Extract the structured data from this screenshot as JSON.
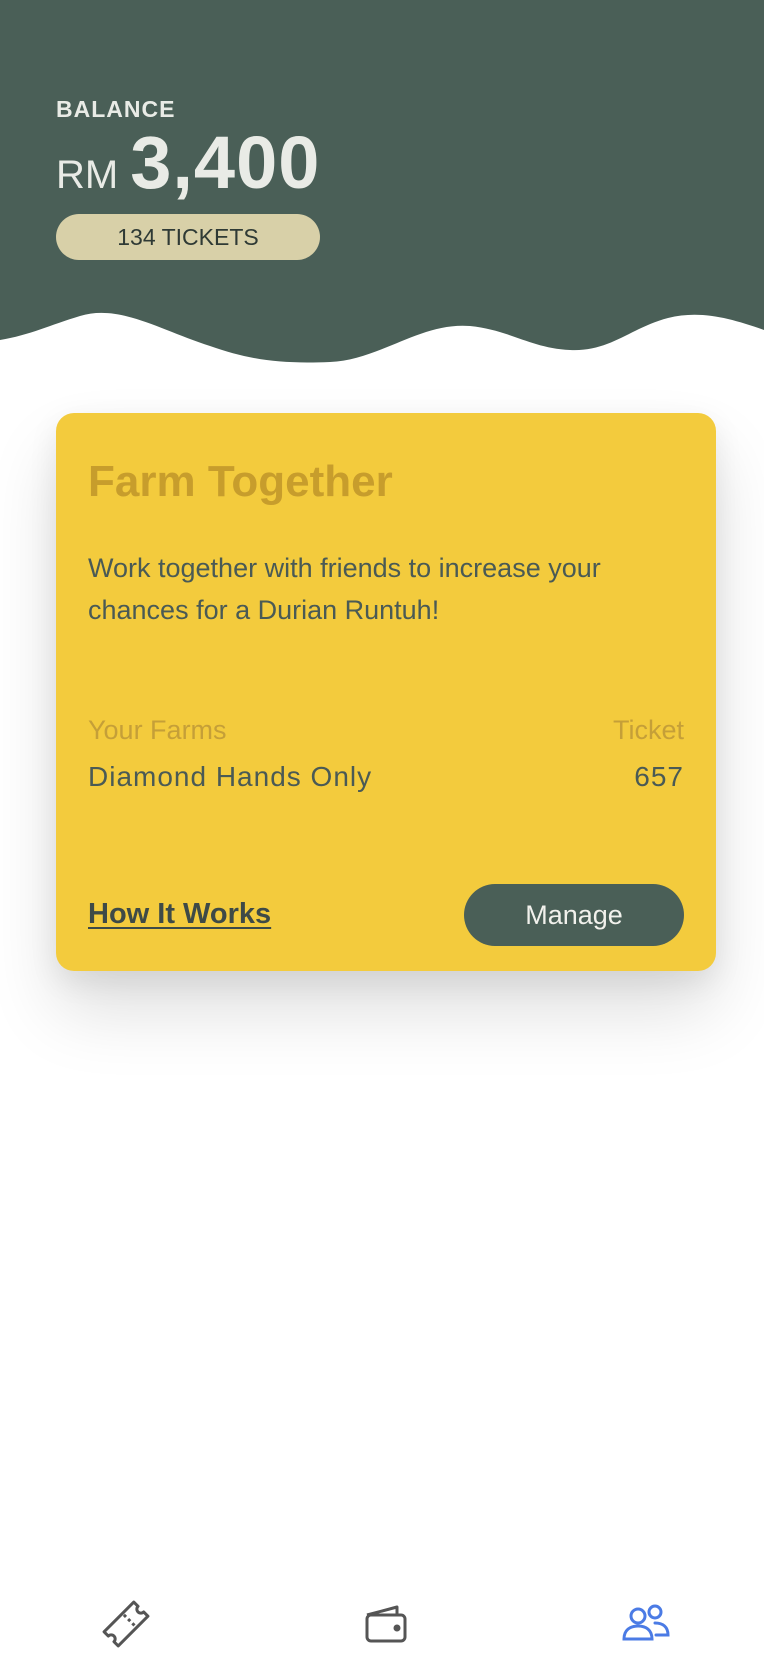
{
  "header": {
    "balance_label": "BALANCE",
    "currency": "RM",
    "amount": "3,400",
    "tickets": "134 TICKETS",
    "bg_color": "#4a5f57"
  },
  "card": {
    "title": "Farm Together",
    "description": "Work together with friends to increase your chances for a Durian Runtuh!",
    "farms_header": "Your Farms",
    "ticket_header": "Ticket",
    "farms": [
      {
        "name": "Diamond Hands Only",
        "tickets": "657"
      }
    ],
    "how_it_works": "How It Works",
    "manage": "Manage",
    "bg_color": "#f3cb3d"
  },
  "nav": {
    "items": [
      {
        "icon": "ticket-icon",
        "active": false
      },
      {
        "icon": "wallet-icon",
        "active": false
      },
      {
        "icon": "users-icon",
        "active": true
      }
    ],
    "active_color": "#4b7be5",
    "inactive_color": "#555555"
  }
}
